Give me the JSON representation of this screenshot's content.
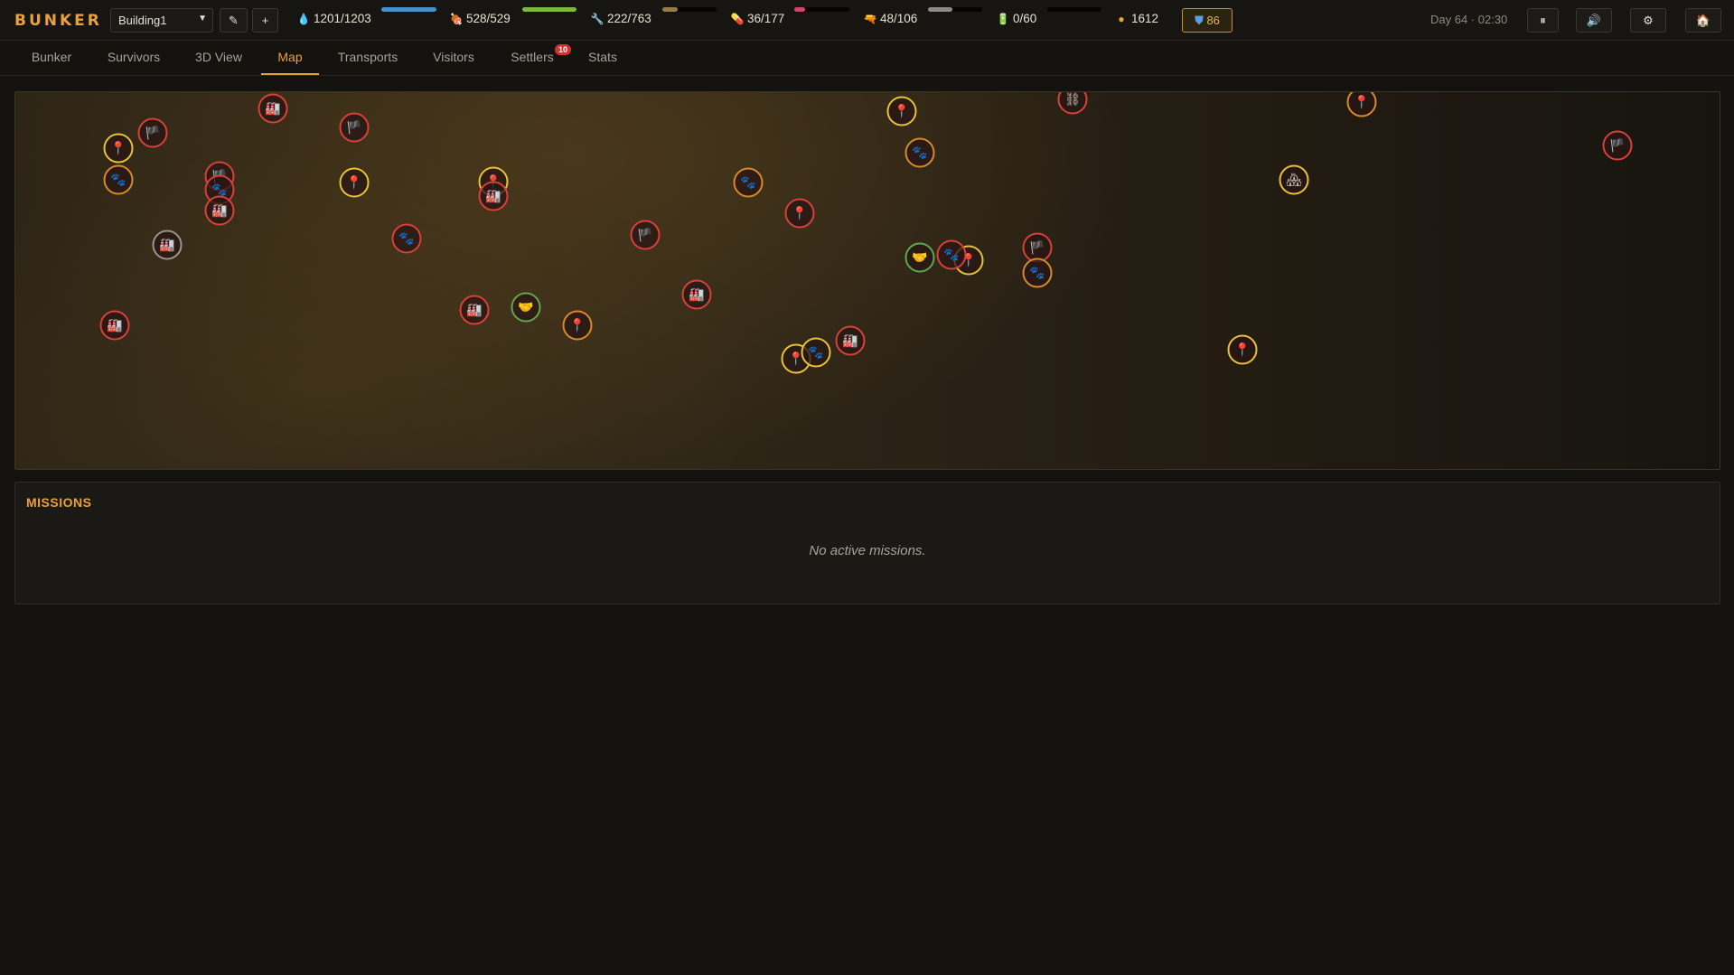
{
  "app": {
    "logo": "BUNKER"
  },
  "toolbar": {
    "building_select": "Building1",
    "edit_label": "✎",
    "add_label": "+"
  },
  "resources": {
    "water": {
      "icon": "water-drop-icon",
      "text": "1201/1203",
      "fraction": 0.998,
      "color": "#4a90c8"
    },
    "food": {
      "icon": "meat-icon",
      "text": "528/529",
      "fraction": 0.998,
      "color": "#7ab83e"
    },
    "materials": {
      "icon": "tools-icon",
      "text": "222/763",
      "fraction": 0.29,
      "color": "#9a7a4a"
    },
    "medicine": {
      "icon": "pill-icon",
      "text": "36/177",
      "fraction": 0.2,
      "color": "#d0456a"
    },
    "weapons": {
      "icon": "gun-icon",
      "text": "48/106",
      "fraction": 0.45,
      "color": "#8a8a8a"
    },
    "fuel": {
      "icon": "battery-icon",
      "text": "0/60",
      "fraction": 0.0,
      "color": "#4a78c8"
    },
    "coins": {
      "icon": "coin-icon",
      "text": "1612"
    },
    "defense": {
      "icon": "shield-icon",
      "text": "86"
    }
  },
  "clock": {
    "text": "Day 64 · 02:30"
  },
  "controls": {
    "pause_label": "⏸",
    "sound_label": "🔊",
    "settings_label": "⚙",
    "home_label": "🏠"
  },
  "tabs": [
    {
      "label": "Bunker"
    },
    {
      "label": "Survivors"
    },
    {
      "label": "3D View"
    },
    {
      "label": "Map",
      "active": true
    },
    {
      "label": "Transports"
    },
    {
      "label": "Visitors"
    },
    {
      "label": "Settlers",
      "badge": "10"
    },
    {
      "label": "Stats"
    }
  ],
  "map": {
    "markers": [
      {
        "type": "pin",
        "glyph": "📍",
        "color": "yellow"
      },
      {
        "type": "flag",
        "glyph": "🏴",
        "color": "red"
      },
      {
        "type": "factory",
        "glyph": "🏭",
        "color": "red"
      },
      {
        "type": "flag",
        "glyph": "🏴",
        "color": "red"
      },
      {
        "type": "paw",
        "glyph": "🐾",
        "color": "orange"
      },
      {
        "type": "flag",
        "glyph": "🏴",
        "color": "red"
      },
      {
        "type": "paw",
        "glyph": "🐾",
        "color": "red"
      },
      {
        "type": "factory",
        "glyph": "🏭",
        "color": "red"
      },
      {
        "type": "pin",
        "glyph": "📍",
        "color": "yellow"
      },
      {
        "type": "pin",
        "glyph": "📍",
        "color": "yellow"
      },
      {
        "type": "factory",
        "glyph": "🏭",
        "color": "red"
      },
      {
        "type": "factory",
        "glyph": "🏭",
        "color": "grey"
      },
      {
        "type": "paw",
        "glyph": "🐾",
        "color": "red"
      },
      {
        "type": "factory",
        "glyph": "🏭",
        "color": "red"
      },
      {
        "type": "factory",
        "glyph": "🏭",
        "color": "red"
      },
      {
        "type": "handshake",
        "glyph": "🤝",
        "color": "green"
      },
      {
        "type": "pin",
        "glyph": "📍",
        "color": "orange"
      },
      {
        "type": "flag",
        "glyph": "🏴",
        "color": "red"
      },
      {
        "type": "factory",
        "glyph": "🏭",
        "color": "red"
      },
      {
        "type": "paw",
        "glyph": "🐾",
        "color": "orange"
      },
      {
        "type": "pin",
        "glyph": "📍",
        "color": "red"
      },
      {
        "type": "pin",
        "glyph": "📍",
        "color": "yellow"
      },
      {
        "type": "paw",
        "glyph": "🐾",
        "color": "yellow"
      },
      {
        "type": "factory",
        "glyph": "🏭",
        "color": "red"
      },
      {
        "type": "pin",
        "glyph": "📍",
        "color": "yellow"
      },
      {
        "type": "paw",
        "glyph": "🐾",
        "color": "orange"
      },
      {
        "type": "handshake",
        "glyph": "🤝",
        "color": "green"
      },
      {
        "type": "pin",
        "glyph": "📍",
        "color": "yellow"
      },
      {
        "type": "paw",
        "glyph": "🐾",
        "color": "red"
      },
      {
        "type": "chains",
        "glyph": "⛓",
        "color": "red"
      },
      {
        "type": "flag",
        "glyph": "🏴",
        "color": "red"
      },
      {
        "type": "paw",
        "glyph": "🐾",
        "color": "orange"
      },
      {
        "type": "pin",
        "glyph": "📍",
        "color": "yellow"
      },
      {
        "type": "camp",
        "glyph": "🏘",
        "color": "yellow"
      },
      {
        "type": "pin",
        "glyph": "📍",
        "color": "orange"
      },
      {
        "type": "flag",
        "glyph": "🏴",
        "color": "red"
      }
    ]
  },
  "missions": {
    "title": "MISSIONS",
    "empty_text": "No active missions."
  }
}
